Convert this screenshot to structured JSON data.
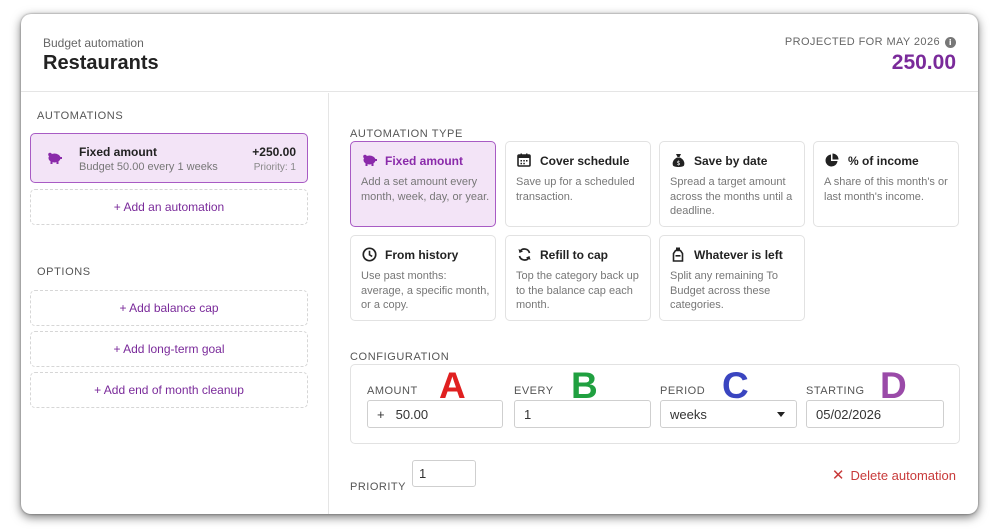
{
  "header": {
    "subtitle": "Budget automation",
    "title": "Restaurants",
    "projected_label": "PROJECTED FOR MAY 2026",
    "projected_value": "250.00"
  },
  "left": {
    "automations_label": "AUTOMATIONS",
    "automation": {
      "icon": "piggy-bank-icon",
      "name": "Fixed amount",
      "description": "Budget 50.00 every 1 weeks",
      "amount": "+250.00",
      "priority": "Priority: 1"
    },
    "add_automation": "+ Add an automation",
    "options_label": "OPTIONS",
    "options": [
      "+ Add balance cap",
      "+ Add long-term goal",
      "+ Add end of month cleanup"
    ]
  },
  "automation_type": {
    "label": "AUTOMATION TYPE",
    "types": [
      {
        "name": "Fixed amount",
        "icon": "piggy-bank-icon",
        "desc": "Add a set amount every month, week, day, or year.",
        "selected": true
      },
      {
        "name": "Cover schedule",
        "icon": "calendar-icon",
        "desc": "Save up for a scheduled transaction."
      },
      {
        "name": "Save by date",
        "icon": "money-bag-icon",
        "desc": "Spread a target amount across the months until a deadline."
      },
      {
        "name": "% of income",
        "icon": "pie-chart-icon",
        "desc": "A share of this month's or last month's income."
      },
      {
        "name": "From history",
        "icon": "clock-icon",
        "desc": "Use past months: average, a specific month, or a copy."
      },
      {
        "name": "Refill to cap",
        "icon": "refresh-icon",
        "desc": "Top the category back up to the balance cap each month."
      },
      {
        "name": "Whatever is left",
        "icon": "bottle-icon",
        "desc": "Split any remaining To Budget across these categories."
      }
    ]
  },
  "configuration": {
    "label": "CONFIGURATION",
    "amount_label": "AMOUNT",
    "amount_prefix": "+",
    "amount_value": "50.00",
    "every_label": "EVERY",
    "every_value": "1",
    "period_label": "PERIOD",
    "period_value": "weeks",
    "starting_label": "STARTING",
    "starting_value": "05/02/2026",
    "annotations": [
      {
        "letter": "A",
        "color": "#e02020"
      },
      {
        "letter": "B",
        "color": "#20a040"
      },
      {
        "letter": "C",
        "color": "#3a45c0"
      },
      {
        "letter": "D",
        "color": "#9a4aa8"
      }
    ]
  },
  "footer": {
    "priority_label": "PRIORITY",
    "priority_value": "1",
    "delete_label": "Delete automation"
  },
  "colors": {
    "accent": "#7a2a9a",
    "selected_bg": "#f3e4f7",
    "danger": "#c83a3a"
  }
}
